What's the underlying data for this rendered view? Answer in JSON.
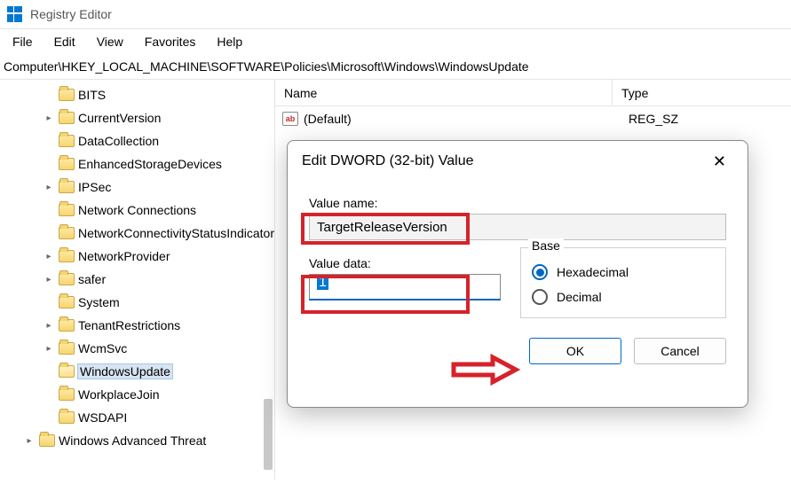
{
  "app": {
    "title": "Registry Editor"
  },
  "menu": {
    "file": "File",
    "edit": "Edit",
    "view": "View",
    "favorites": "Favorites",
    "help": "Help"
  },
  "path": "Computer\\HKEY_LOCAL_MACHINE\\SOFTWARE\\Policies\\Microsoft\\Windows\\WindowsUpdate",
  "tree": {
    "items": [
      {
        "label": "BITS",
        "expandable": false,
        "level": 1
      },
      {
        "label": "CurrentVersion",
        "expandable": true,
        "level": 1
      },
      {
        "label": "DataCollection",
        "expandable": false,
        "level": 1
      },
      {
        "label": "EnhancedStorageDevices",
        "expandable": false,
        "level": 1
      },
      {
        "label": "IPSec",
        "expandable": true,
        "level": 1
      },
      {
        "label": "Network Connections",
        "expandable": false,
        "level": 1
      },
      {
        "label": "NetworkConnectivityStatusIndicator",
        "expandable": false,
        "level": 1
      },
      {
        "label": "NetworkProvider",
        "expandable": true,
        "level": 1
      },
      {
        "label": "safer",
        "expandable": true,
        "level": 1
      },
      {
        "label": "System",
        "expandable": false,
        "level": 1
      },
      {
        "label": "TenantRestrictions",
        "expandable": true,
        "level": 1
      },
      {
        "label": "WcmSvc",
        "expandable": true,
        "level": 1
      },
      {
        "label": "WindowsUpdate",
        "expandable": false,
        "level": 1,
        "selected": true,
        "open": true
      },
      {
        "label": "WorkplaceJoin",
        "expandable": false,
        "level": 1
      },
      {
        "label": "WSDAPI",
        "expandable": false,
        "level": 1
      },
      {
        "label": "Windows Advanced Threat",
        "expandable": true,
        "level": 0
      }
    ]
  },
  "list": {
    "col_name": "Name",
    "col_type": "Type",
    "rows": [
      {
        "name": "(Default)",
        "type": "REG_SZ",
        "icon": "ab"
      }
    ]
  },
  "dialog": {
    "title": "Edit DWORD (32-bit) Value",
    "value_name_label": "Value name:",
    "value_name": "TargetReleaseVersion",
    "value_data_label": "Value data:",
    "value_data": "1",
    "base_label": "Base",
    "hex_label": "Hexadecimal",
    "dec_label": "Decimal",
    "base_selected": "hex",
    "ok": "OK",
    "cancel": "Cancel"
  }
}
